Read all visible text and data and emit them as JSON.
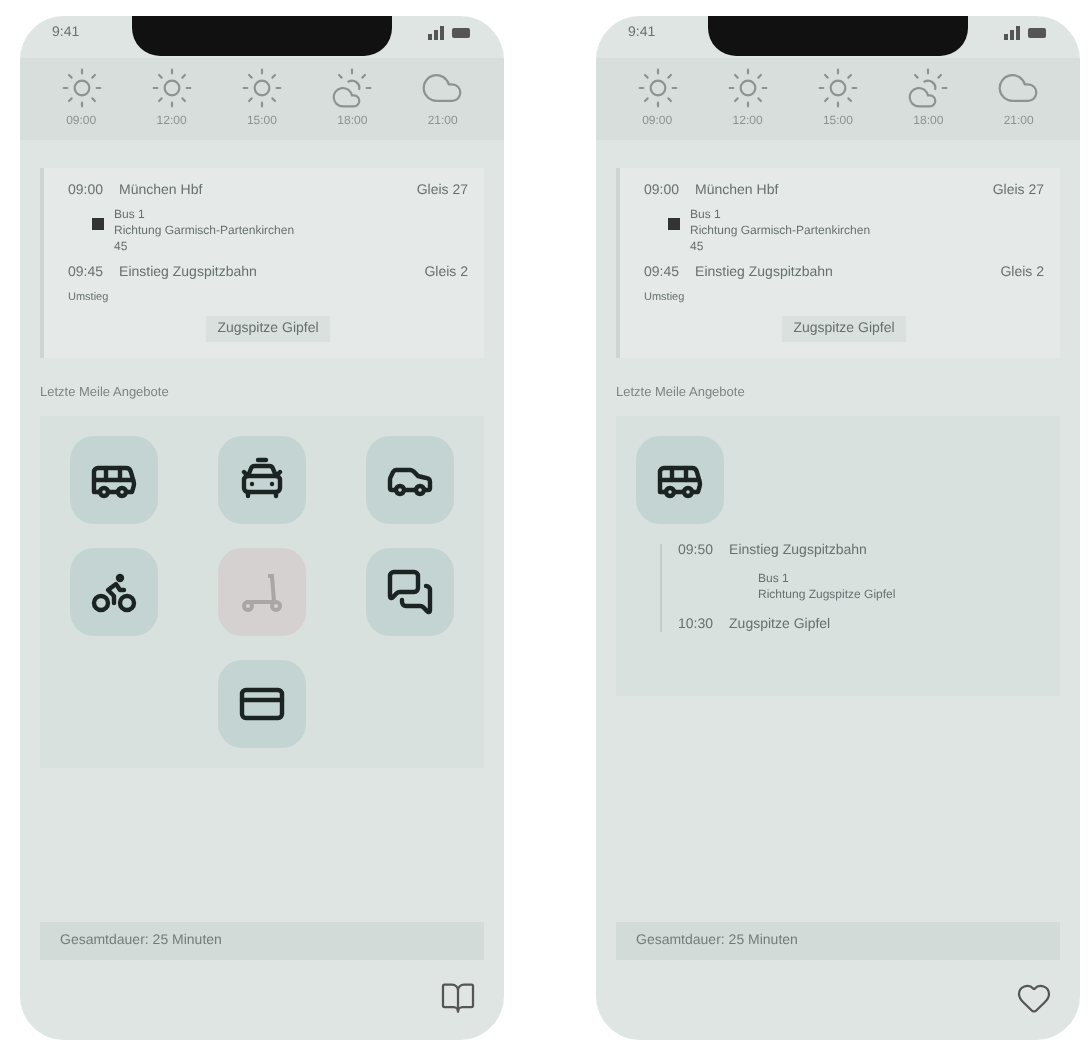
{
  "phones": [
    {
      "status_time": "9:41",
      "weather": [
        {
          "kind": "sun",
          "time": "09:00"
        },
        {
          "kind": "sun",
          "time": "12:00"
        },
        {
          "kind": "sun",
          "time": "15:00"
        },
        {
          "kind": "partly",
          "time": "18:00"
        },
        {
          "kind": "cloud",
          "time": "21:00"
        }
      ],
      "trip": {
        "first": {
          "time": "09:00",
          "place": "München Hbf",
          "track": "Gleis 27"
        },
        "vehicle": {
          "line": "Bus 1",
          "direction": "Richtung Garmisch-Partenkirchen",
          "note": "45"
        },
        "second": {
          "time": "09:45",
          "place": "Einstieg Zugspitzbahn",
          "track": "Gleis 2"
        },
        "transfer": "Umstieg",
        "final": "Zugspitze Gipfel"
      },
      "section_title": "Letzte Meile Angebote",
      "options": [
        {
          "kind": "bus",
          "disabled": false
        },
        {
          "kind": "taxi",
          "disabled": false
        },
        {
          "kind": "car",
          "disabled": false
        },
        {
          "kind": "bike",
          "disabled": false
        },
        {
          "kind": "scooter",
          "disabled": true
        },
        {
          "kind": "chat",
          "disabled": false
        },
        {
          "kind": "card",
          "disabled": false
        }
      ],
      "footer": "Gesamtdauer: 25 Minuten",
      "corner": {
        "kind": "book"
      }
    },
    {
      "status_time": "9:41",
      "weather": [
        {
          "kind": "sun",
          "time": "09:00"
        },
        {
          "kind": "sun",
          "time": "12:00"
        },
        {
          "kind": "sun",
          "time": "15:00"
        },
        {
          "kind": "partly",
          "time": "18:00"
        },
        {
          "kind": "cloud",
          "time": "21:00"
        }
      ],
      "trip": {
        "first": {
          "time": "09:00",
          "place": "München Hbf",
          "track": "Gleis 27"
        },
        "vehicle": {
          "line": "Bus 1",
          "direction": "Richtung Garmisch-Partenkirchen",
          "note": "45"
        },
        "second": {
          "time": "09:45",
          "place": "Einstieg Zugspitzbahn",
          "track": "Gleis 2"
        },
        "transfer": "Umstieg",
        "final": "Zugspitze Gipfel"
      },
      "section_title": "Letzte Meile Angebote",
      "detail": {
        "kind": "bus",
        "legs": [
          {
            "time": "09:50",
            "place": "Einstieg Zugspitzbahn"
          },
          {
            "time": "10:30",
            "place": "Zugspitze Gipfel"
          }
        ],
        "line": "Bus 1",
        "direction": "Richtung Zugspitze Gipfel"
      },
      "footer": "Gesamtdauer: 25 Minuten",
      "corner": {
        "kind": "heart"
      }
    }
  ]
}
